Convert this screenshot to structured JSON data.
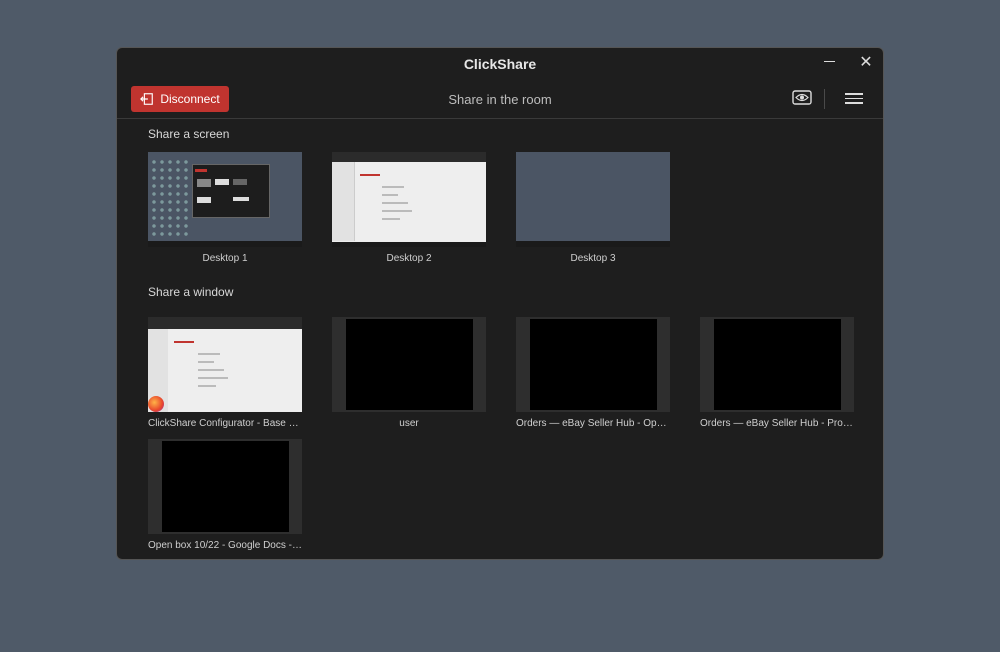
{
  "window": {
    "title": "ClickShare",
    "minimize_icon": "minimize-icon",
    "close_icon": "close-icon"
  },
  "toolbar": {
    "disconnect_label": "Disconnect",
    "disconnect_icon": "exit-icon",
    "room_label": "Share in the room",
    "preview_icon": "eye-icon",
    "menu_icon": "hamburger-menu-icon",
    "accent": "#c0342f"
  },
  "screens": {
    "title": "Share a screen",
    "items": [
      {
        "label": "Desktop 1"
      },
      {
        "label": "Desktop 2"
      },
      {
        "label": "Desktop 3"
      }
    ]
  },
  "windows": {
    "title": "Share a window",
    "items": [
      {
        "label": "ClickShare Configurator - Base Unit ..."
      },
      {
        "label": "user"
      },
      {
        "label": "Orders — eBay Seller Hub - Opera"
      },
      {
        "label": "Orders — eBay Seller Hub - Profile 1..."
      },
      {
        "label": "Open box 10/22 - Google Docs - Go..."
      }
    ]
  }
}
